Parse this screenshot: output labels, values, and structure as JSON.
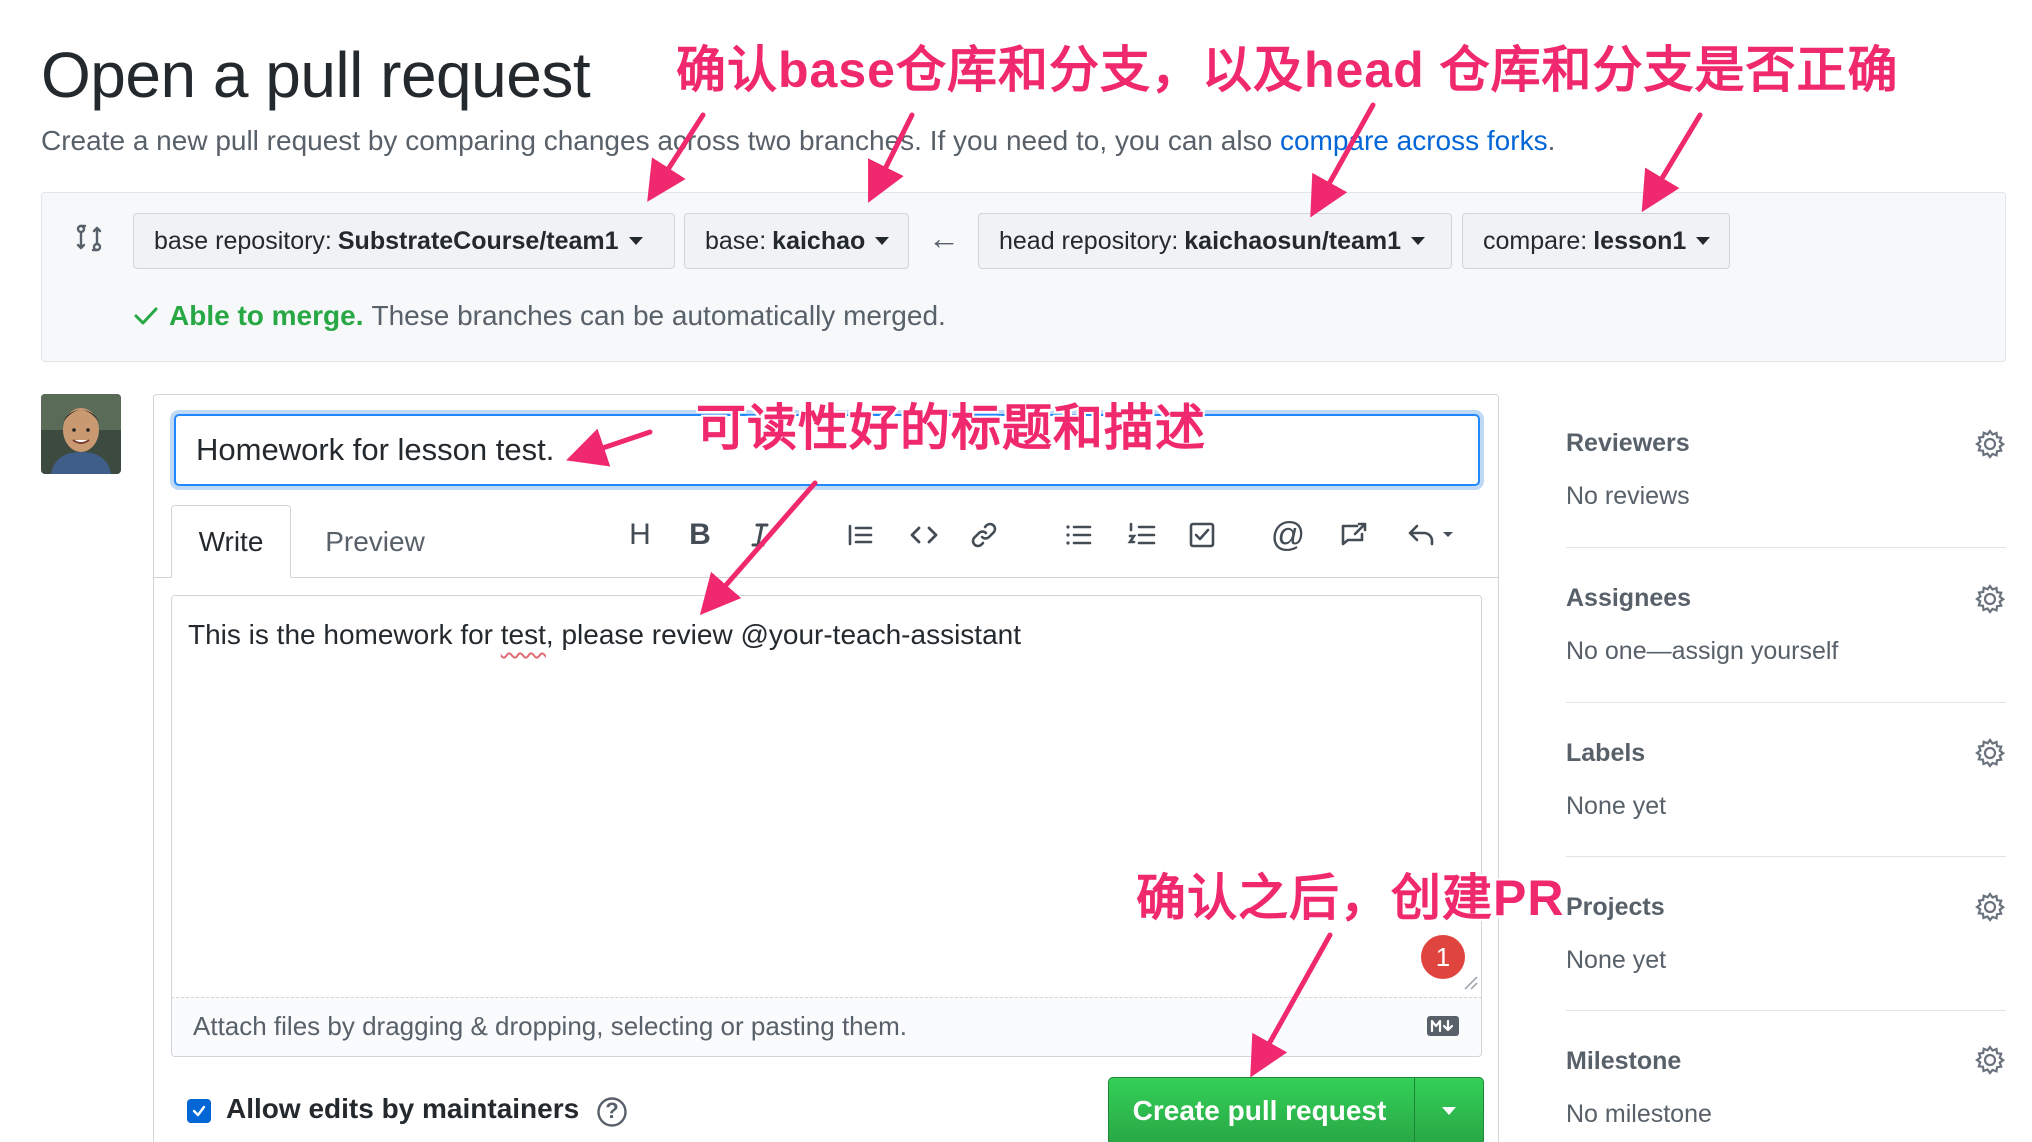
{
  "page": {
    "title": "Open a pull request",
    "subtitle_prefix": "Create a new pull request by comparing changes across two branches. If you need to, you can also ",
    "subtitle_link": "compare across forks",
    "subtitle_suffix": "."
  },
  "compare": {
    "base_repo_label": "base repository:",
    "base_repo_value": "SubstrateCourse/team1",
    "base_label": "base:",
    "base_value": "kaichao",
    "direction_arrow": "←",
    "head_repo_label": "head repository:",
    "head_repo_value": "kaichaosun/team1",
    "compare_label": "compare:",
    "compare_value": "lesson1",
    "merge_status": "Able to merge.",
    "merge_message": "These branches can be automatically merged.",
    "status_color": "#28a745"
  },
  "form": {
    "title_value": "Homework for lesson test.",
    "tabs": [
      {
        "label": "Write"
      },
      {
        "label": "Preview"
      }
    ],
    "toolbar": {
      "icons": [
        "header-icon",
        "bold-icon",
        "italic-icon",
        "quote-icon",
        "code-icon",
        "link-icon",
        "unordered-list-icon",
        "ordered-list-icon",
        "task-list-icon",
        "mention-icon",
        "reference-icon",
        "reply-icon"
      ],
      "header_glyph": "H",
      "bold_glyph": "B",
      "mention_glyph": "@"
    },
    "body_before": "This is the homework for ",
    "body_spell": "test",
    "body_after": ", please review @your-teach-assistant",
    "notification_count": "1",
    "attach_hint": "Attach files by dragging & dropping, selecting or pasting them.",
    "allow_edits_label": "Allow edits by maintainers",
    "allow_edits_checked": true,
    "help_glyph": "?",
    "submit_label": "Create pull request",
    "accent_color": "#28a745"
  },
  "sidebar": {
    "sections": [
      {
        "title": "Reviewers",
        "value": "No reviews"
      },
      {
        "title": "Assignees",
        "value": "No one—assign yourself"
      },
      {
        "title": "Labels",
        "value": "None yet"
      },
      {
        "title": "Projects",
        "value": "None yet"
      },
      {
        "title": "Milestone",
        "value": "No milestone"
      }
    ]
  },
  "annotations": {
    "top": "确认base仓库和分支，以及head 仓库和分支是否正确",
    "middle": "可读性好的标题和描述",
    "bottom": "确认之后，创建PR",
    "color": "#f0286d"
  }
}
